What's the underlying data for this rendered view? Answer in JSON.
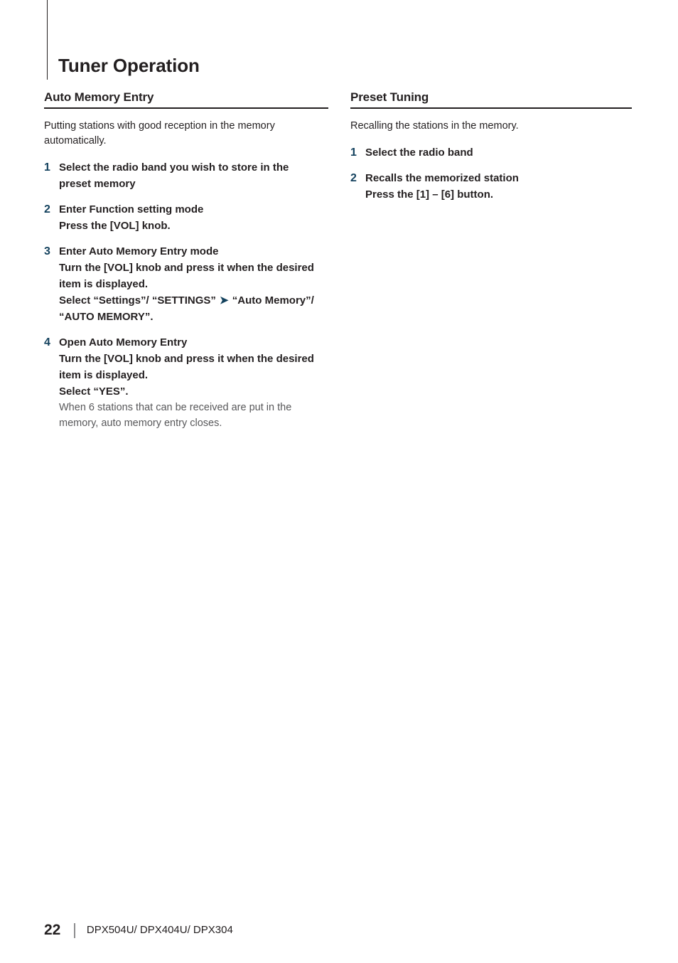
{
  "document": {
    "chapter_title": "Tuner Operation",
    "accent_color": "#14425e",
    "text_color": "#231f20",
    "note_color": "#58585a"
  },
  "left_column": {
    "heading": "Auto Memory Entry",
    "lead": "Putting stations with good reception in the memory automatically.",
    "steps": [
      {
        "number": "1",
        "title": "Select the radio band you wish to store in the preset memory"
      },
      {
        "number": "2",
        "title": "Enter Function setting mode",
        "detail": "Press the [VOL] knob."
      },
      {
        "number": "3",
        "title": "Enter Auto Memory Entry mode",
        "detail": "Turn the [VOL] knob and press it when the desired item is displayed.",
        "detail2_before": "Select “Settings”/ “SETTINGS” ",
        "detail2_chevron": "➤",
        "detail2_after": " “Auto Memory”/ “AUTO MEMORY”."
      },
      {
        "number": "4",
        "title": "Open Auto Memory Entry",
        "detail": "Turn the [VOL] knob and press it when the desired item is displayed.",
        "detail2": "Select “YES”.",
        "note": "When 6 stations that can be received are put in the memory, auto memory entry closes."
      }
    ]
  },
  "right_column": {
    "heading": "Preset Tuning",
    "lead": "Recalling the stations in the memory.",
    "steps": [
      {
        "number": "1",
        "title": "Select the radio band"
      },
      {
        "number": "2",
        "title": "Recalls the memorized station",
        "detail": "Press the [1] – [6] button."
      }
    ]
  },
  "footer": {
    "page_number": "22",
    "models": "DPX504U/ DPX404U/ DPX304"
  }
}
